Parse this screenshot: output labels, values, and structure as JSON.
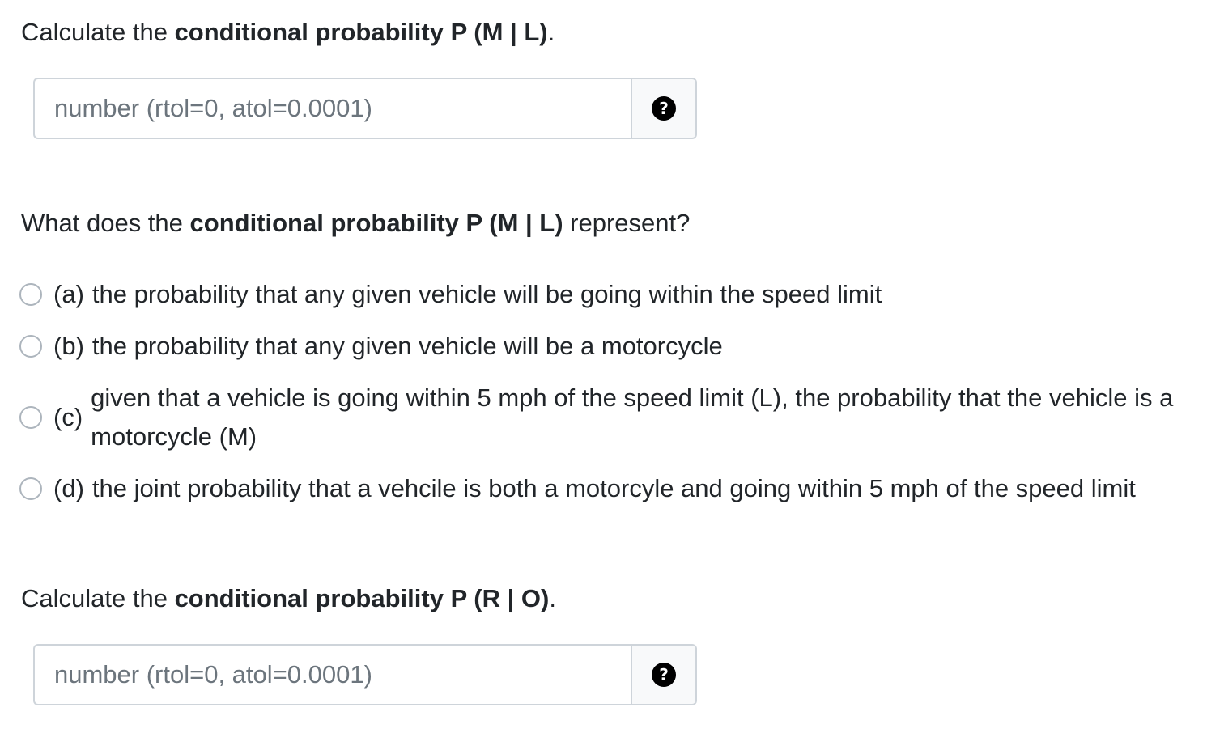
{
  "q1": {
    "prefix": "Calculate the ",
    "bold": "conditional probability P (M | L)",
    "suffix": ".",
    "placeholder": "number (rtol=0, atol=0.0001)",
    "help_glyph": "?"
  },
  "q2": {
    "prefix": "What does the ",
    "bold": "conditional probability P (M | L)",
    "suffix": " represent?",
    "options": [
      {
        "key": "(a)",
        "text": "the probability that any given vehicle will be going within the speed limit"
      },
      {
        "key": "(b)",
        "text": "the probability that any given vehicle will be a motorcycle"
      },
      {
        "key": "(c)",
        "text": "given that a vehicle is going within 5 mph of the speed limit (L), the probability that the vehicle is a motorcycle (M)"
      },
      {
        "key": "(d)",
        "text": "the joint probability that a vehcile is both a motorcyle and going within 5 mph of the speed limit"
      }
    ]
  },
  "q3": {
    "prefix": "Calculate the ",
    "bold": "conditional probability P (R | O)",
    "suffix": ".",
    "placeholder": "number (rtol=0, atol=0.0001)",
    "help_glyph": "?"
  },
  "icons": {
    "help": "question-circle-icon",
    "radio": "radio-button"
  },
  "colors": {
    "text": "#212529",
    "placeholder": "#6c757d",
    "border": "#ced4da",
    "addon_bg": "#f8f9fa",
    "icon": "#000000"
  }
}
